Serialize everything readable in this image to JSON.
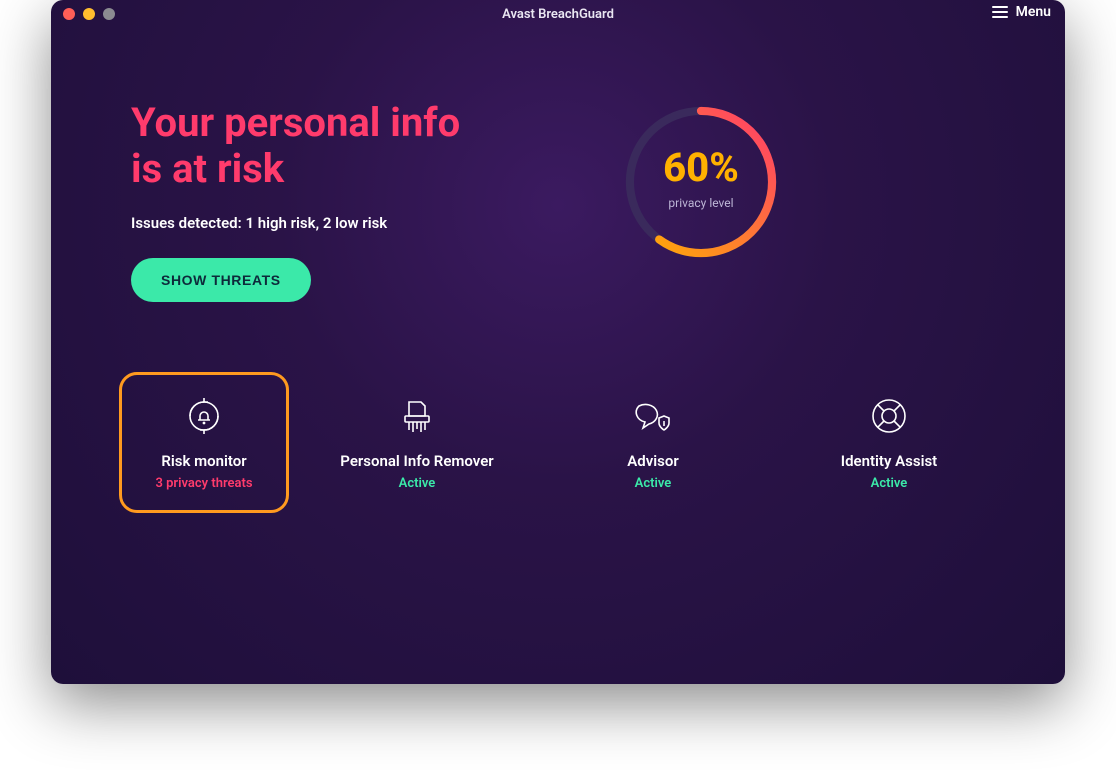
{
  "titlebar": {
    "title": "Avast BreachGuard",
    "menu_label": "Menu"
  },
  "hero": {
    "title_line1": "Your personal info",
    "title_line2": "is at risk",
    "subtitle": "Issues detected: 1 high risk, 2 low risk",
    "cta_label": "SHOW THREATS"
  },
  "gauge": {
    "percent": 60,
    "value_text": "60%",
    "label": "privacy level"
  },
  "tiles": [
    {
      "title": "Risk monitor",
      "status": "3 privacy threats",
      "status_kind": "threat",
      "highlighted": true,
      "icon": "refresh-bell-icon"
    },
    {
      "title": "Personal Info Remover",
      "status": "Active",
      "status_kind": "active",
      "highlighted": false,
      "icon": "shredder-icon"
    },
    {
      "title": "Advisor",
      "status": "Active",
      "status_kind": "active",
      "highlighted": false,
      "icon": "chat-shield-icon"
    },
    {
      "title": "Identity Assist",
      "status": "Active",
      "status_kind": "active",
      "highlighted": false,
      "icon": "lifebuoy-icon"
    }
  ],
  "colors": {
    "accent_pink": "#ff3b6c",
    "accent_green": "#3be9a9",
    "accent_orange": "#ff9a1f",
    "gauge_amber": "#ffb100"
  }
}
